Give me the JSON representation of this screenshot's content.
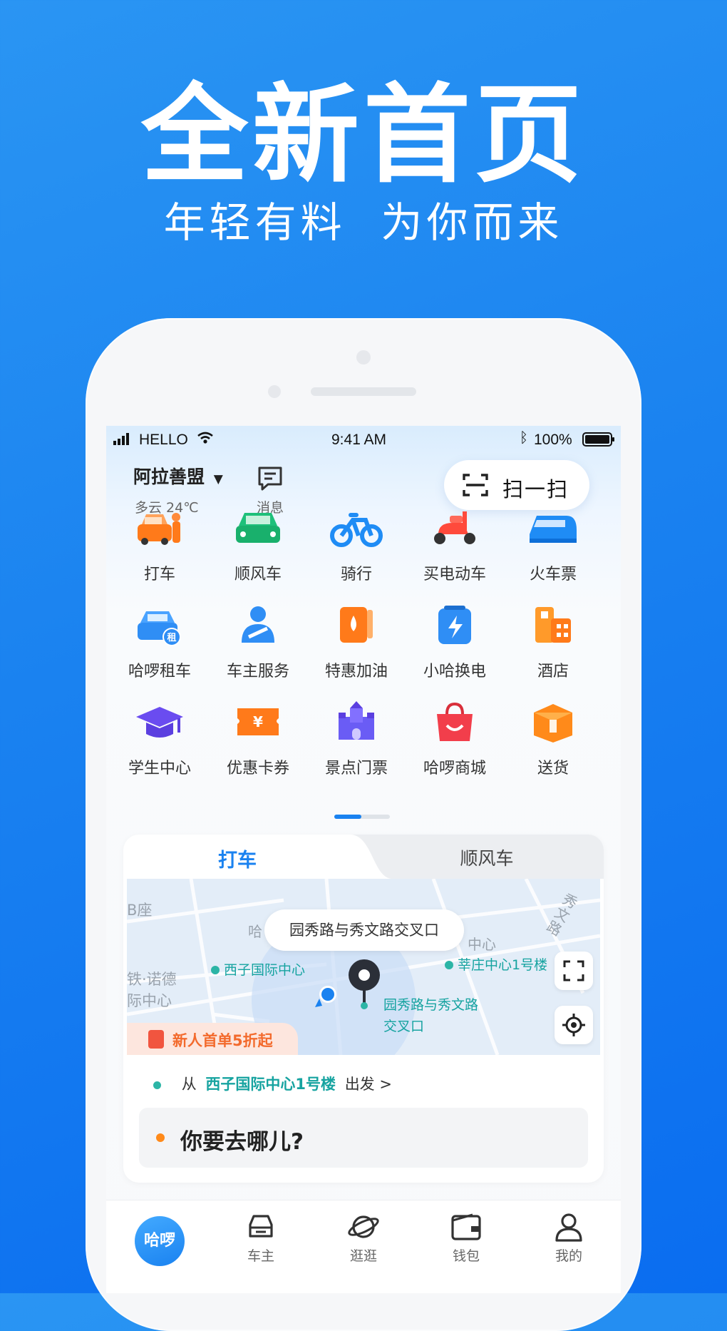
{
  "hero": {
    "title": "全新首页",
    "subtitle": "年轻有料  为你而来"
  },
  "status_bar": {
    "carrier": "HELLO",
    "time": "9:41 AM",
    "battery": "100%"
  },
  "header": {
    "city": "阿拉善盟",
    "weather": "多云 24℃",
    "message_label": "消息",
    "scan_label": "扫一扫"
  },
  "services": [
    {
      "label": "打车",
      "icon": "taxi-icon"
    },
    {
      "label": "顺风车",
      "icon": "green-car-icon"
    },
    {
      "label": "骑行",
      "icon": "bicycle-icon"
    },
    {
      "label": "买电动车",
      "icon": "scooter-icon"
    },
    {
      "label": "火车票",
      "icon": "train-icon"
    },
    {
      "label": "哈啰租车",
      "icon": "rental-car-icon"
    },
    {
      "label": "车主服务",
      "icon": "owner-service-icon"
    },
    {
      "label": "特惠加油",
      "icon": "fuel-icon"
    },
    {
      "label": "小哈换电",
      "icon": "battery-swap-icon"
    },
    {
      "label": "酒店",
      "icon": "hotel-icon"
    },
    {
      "label": "学生中心",
      "icon": "graduation-cap-icon"
    },
    {
      "label": "优惠卡券",
      "icon": "coupon-icon"
    },
    {
      "label": "景点门票",
      "icon": "castle-icon"
    },
    {
      "label": "哈啰商城",
      "icon": "shopping-bag-icon"
    },
    {
      "label": "送货",
      "icon": "package-icon"
    }
  ],
  "service_badge": "租",
  "coupon_symbol": "¥",
  "ride_card": {
    "tabs": [
      "打车",
      "顺风车"
    ],
    "map": {
      "callout": "园秀路与秀文路交叉口",
      "labels": [
        "B座",
        "哈",
        "中心",
        "秀文路",
        "铁·诺德",
        "际中心"
      ],
      "pois": [
        "西子国际中心",
        "莘庄中心1号楼",
        "园秀路与秀文路",
        "交叉口"
      ],
      "promo": "新人首单5折起"
    },
    "from_prefix": "从",
    "from_place": "西子国际中心1号楼",
    "from_suffix": "出发 >",
    "destination_placeholder": "你要去哪儿?"
  },
  "tabbar": {
    "home_label": "哈啰",
    "items": [
      "车主",
      "逛逛",
      "钱包",
      "我的"
    ]
  },
  "colors": {
    "brand": "#1a82f0",
    "teal": "#16a3a0",
    "orange": "#ff7a1a"
  }
}
